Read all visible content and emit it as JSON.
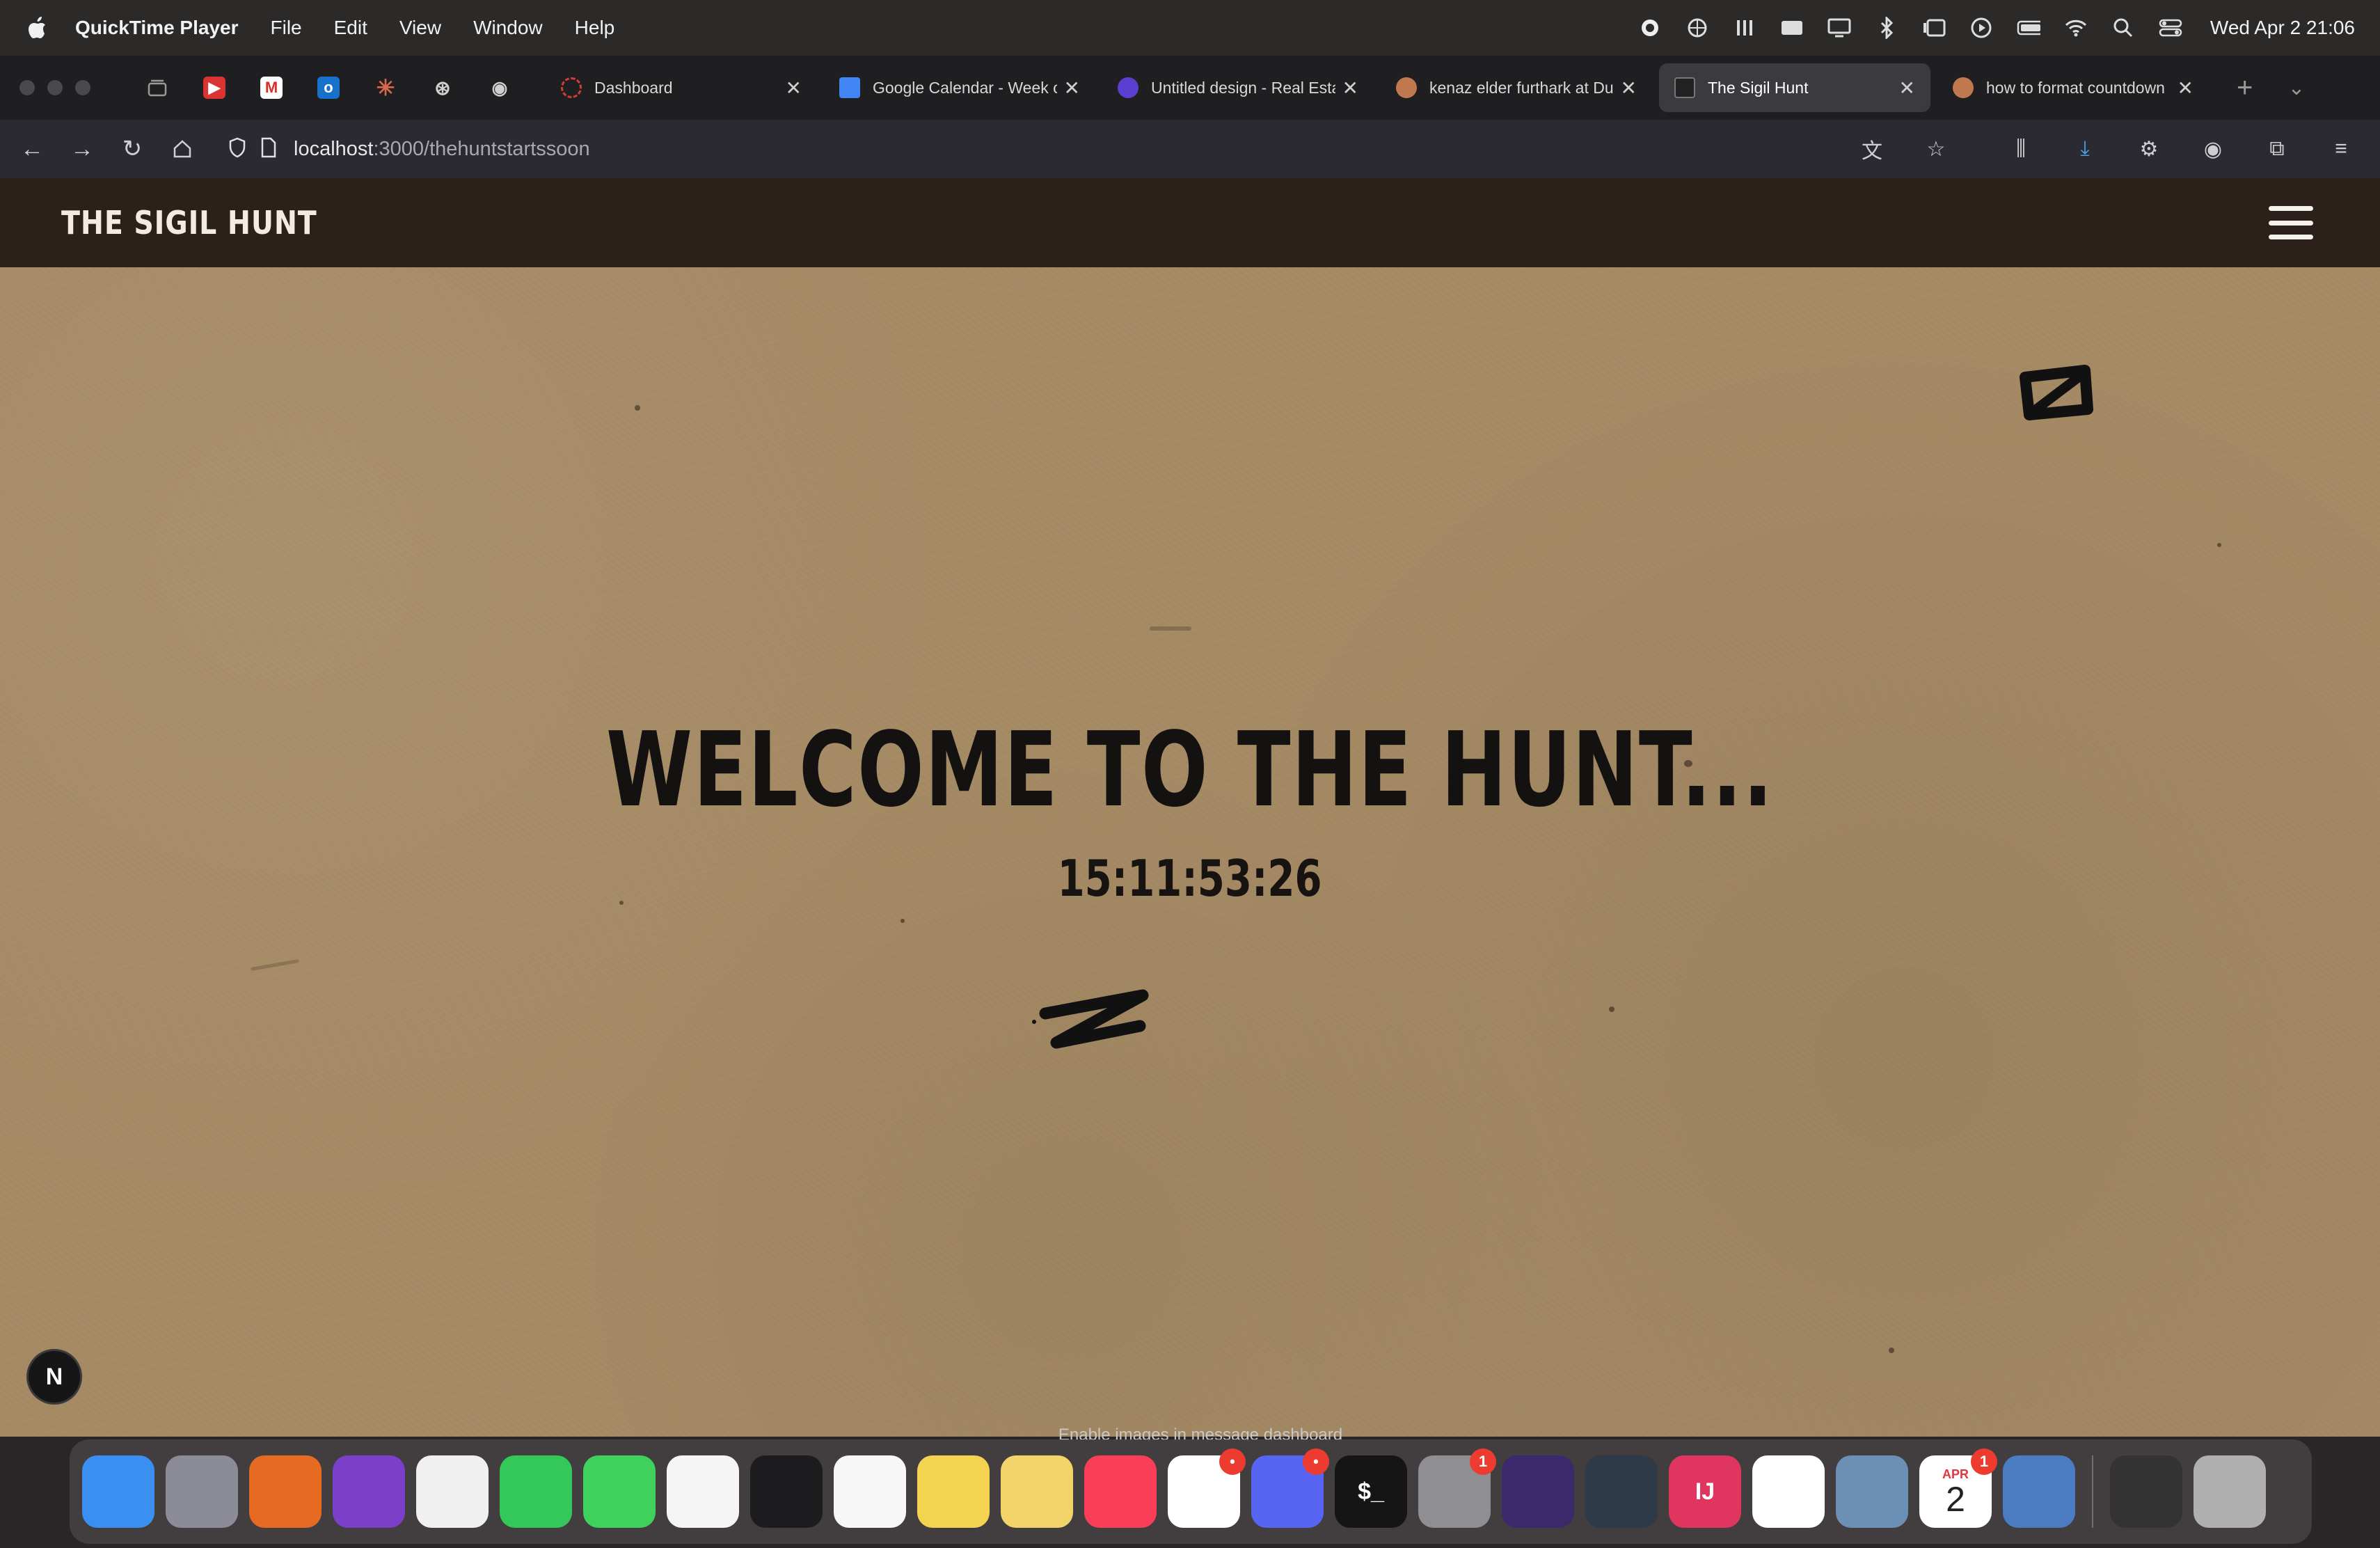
{
  "menubar": {
    "app_name": "QuickTime Player",
    "menus": [
      "File",
      "Edit",
      "View",
      "Window",
      "Help"
    ],
    "clock": "Wed Apr 2  21:06"
  },
  "tabs": [
    {
      "title": "Dashboard",
      "fav_color": "#d23b3b"
    },
    {
      "title": "Google Calendar - Week of",
      "fav_color": "#4285f4"
    },
    {
      "title": "Untitled design - Real Esta",
      "fav_color": "#5b3fd1"
    },
    {
      "title": "kenaz elder furthark at Du",
      "fav_color": "#c0794f"
    },
    {
      "title": "The Sigil Hunt",
      "fav_color": "#222222"
    },
    {
      "title": "how to format countdown",
      "fav_color": "#c0794f"
    }
  ],
  "address": {
    "host": "localhost",
    "path": ":3000/thehuntstartssoon"
  },
  "site": {
    "brand": "THE SIGIL HUNT",
    "heading": "WELCOME TO THE HUNT...",
    "countdown": "15:11:53:26",
    "dev_badge": "N"
  },
  "dock": {
    "tooltip": "Enable images in message dashboard",
    "apps": [
      {
        "name": "finder",
        "color": "#3b8ff0",
        "label": ""
      },
      {
        "name": "launchpad",
        "color": "#8c8c99",
        "label": ""
      },
      {
        "name": "firefox",
        "color": "#e66a22",
        "label": ""
      },
      {
        "name": "tor-browser",
        "color": "#7b3fc9",
        "label": ""
      },
      {
        "name": "brave",
        "color": "#f0f0f0",
        "label": ""
      },
      {
        "name": "facetime",
        "color": "#34c759",
        "label": ""
      },
      {
        "name": "messages",
        "color": "#3fd15b",
        "label": ""
      },
      {
        "name": "photos",
        "color": "#f5f5f5",
        "label": ""
      },
      {
        "name": "voice-memos",
        "color": "#1c1c1e",
        "label": ""
      },
      {
        "name": "reminders",
        "color": "#f7f7f7",
        "label": ""
      },
      {
        "name": "notes",
        "color": "#f4d350",
        "label": ""
      },
      {
        "name": "stickies",
        "color": "#f2d46a",
        "label": ""
      },
      {
        "name": "music",
        "color": "#fa3e57",
        "label": ""
      },
      {
        "name": "slack",
        "color": "#ffffff",
        "label": "",
        "badge": "•"
      },
      {
        "name": "discord",
        "color": "#5865f2",
        "label": "",
        "badge": "•"
      },
      {
        "name": "terminal",
        "color": "#151515",
        "label": "$_"
      },
      {
        "name": "system-settings",
        "color": "#8e8e93",
        "label": "",
        "badge": "1"
      },
      {
        "name": "obsidian",
        "color": "#3b2a6b",
        "label": ""
      },
      {
        "name": "davinci-resolve",
        "color": "#2f3a48",
        "label": ""
      },
      {
        "name": "intellij",
        "color": "#e0355e",
        "label": "IJ"
      },
      {
        "name": "vscode",
        "color": "#ffffff",
        "label": ""
      },
      {
        "name": "preview",
        "color": "#6c8fb5",
        "label": ""
      },
      {
        "name": "calendar",
        "color": "#ffffff",
        "label": "",
        "badge": "1",
        "month": "APR",
        "day": "2"
      },
      {
        "name": "quicktime",
        "color": "#4b7cc2",
        "label": ""
      },
      {
        "name": "recent-window",
        "color": "#333333",
        "label": ""
      },
      {
        "name": "trash",
        "color": "#b0b0b0",
        "label": ""
      }
    ]
  },
  "colors": {
    "page_background": "#a58a64",
    "site_header": "#2b201a",
    "sigil_ink": "#111111"
  }
}
